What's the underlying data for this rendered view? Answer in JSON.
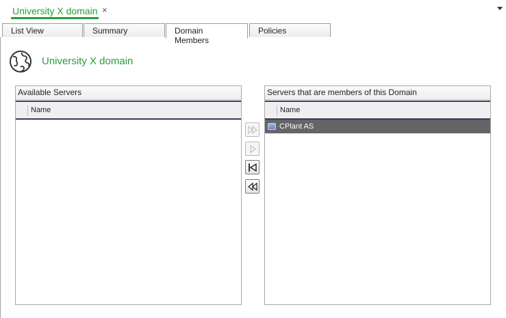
{
  "document_tab": {
    "title": "University X domain",
    "close_glyph": "×"
  },
  "tabs": [
    {
      "label": "List View"
    },
    {
      "label": "Summary"
    },
    {
      "label": "Domain Members",
      "active": true
    },
    {
      "label": "Policies"
    }
  ],
  "page": {
    "title": "University X domain",
    "icon": "globe-icon"
  },
  "available_servers": {
    "title": "Available Servers",
    "columns": [
      "Name"
    ],
    "rows": []
  },
  "member_servers": {
    "title": "Servers that are members of this Domain",
    "columns": [
      "Name"
    ],
    "rows": [
      {
        "name": "CPlant AS",
        "icon": "server-icon",
        "selected": true
      }
    ]
  },
  "move_buttons": [
    {
      "name": "add-all-button",
      "icon": "double-chevron-right-icon",
      "enabled": false
    },
    {
      "name": "add-selected-button",
      "icon": "chevron-right-icon",
      "enabled": false
    },
    {
      "name": "remove-selected-button",
      "icon": "chevron-left-bar-icon",
      "enabled": true
    },
    {
      "name": "remove-all-button",
      "icon": "double-chevron-left-icon",
      "enabled": true
    }
  ],
  "colors": {
    "accent": "#2a9a3a",
    "selection": "#646469"
  }
}
